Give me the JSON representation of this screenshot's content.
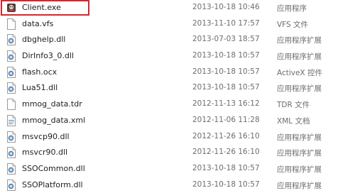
{
  "files": [
    {
      "name": "Client.exe",
      "modified": "2013-10-18 10:46",
      "type": "应用程序",
      "icon": "exe-app-icon"
    },
    {
      "name": "data.vfs",
      "modified": "2013-11-10 17:57",
      "type": "VFS 文件",
      "icon": "blank-file-icon"
    },
    {
      "name": "dbghelp.dll",
      "modified": "2013-07-03 18:57",
      "type": "应用程序扩展",
      "icon": "dll-gear-icon"
    },
    {
      "name": "DirInfo3_0.dll",
      "modified": "2013-10-18 10:57",
      "type": "应用程序扩展",
      "icon": "dll-gear-icon"
    },
    {
      "name": "flash.ocx",
      "modified": "2013-10-18 10:57",
      "type": "ActiveX 控件",
      "icon": "dll-gear-icon"
    },
    {
      "name": "Lua51.dll",
      "modified": "2013-10-18 10:57",
      "type": "应用程序扩展",
      "icon": "dll-gear-icon"
    },
    {
      "name": "mmog_data.tdr",
      "modified": "2012-11-13 16:12",
      "type": "TDR 文件",
      "icon": "blank-file-icon"
    },
    {
      "name": "mmog_data.xml",
      "modified": "2012-11-06 11:28",
      "type": "XML 文档",
      "icon": "xml-doc-icon"
    },
    {
      "name": "msvcp90.dll",
      "modified": "2012-11-26 16:10",
      "type": "应用程序扩展",
      "icon": "dll-gear-icon"
    },
    {
      "name": "msvcr90.dll",
      "modified": "2012-11-26 16:10",
      "type": "应用程序扩展",
      "icon": "dll-gear-icon"
    },
    {
      "name": "SSOCommon.dll",
      "modified": "2013-10-18 10:57",
      "type": "应用程序扩展",
      "icon": "dll-gear-icon"
    },
    {
      "name": "SSOPlatform.dll",
      "modified": "2013-10-18 10:57",
      "type": "应用程序扩展",
      "icon": "dll-gear-icon"
    }
  ],
  "highlight_color": "#d9252b"
}
